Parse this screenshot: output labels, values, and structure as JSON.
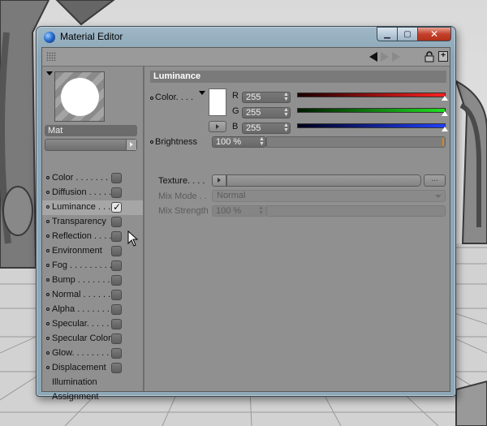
{
  "window": {
    "title": "Material Editor"
  },
  "preview": {
    "material_name": "Mat"
  },
  "channels": [
    {
      "label": "Color . . . . . . . .",
      "enabled": false,
      "active": false
    },
    {
      "label": "Diffusion . . . . . .",
      "enabled": false,
      "active": false
    },
    {
      "label": "Luminance . . . .",
      "enabled": true,
      "active": true
    },
    {
      "label": "Transparency",
      "enabled": false,
      "active": false
    },
    {
      "label": "Reflection . . . . .",
      "enabled": false,
      "active": false
    },
    {
      "label": "Environment",
      "enabled": false,
      "active": false
    },
    {
      "label": "Fog . . . . . . . . . .",
      "enabled": false,
      "active": false
    },
    {
      "label": "Bump . . . . . . . .",
      "enabled": false,
      "active": false
    },
    {
      "label": "Normal . . . . . . .",
      "enabled": false,
      "active": false
    },
    {
      "label": "Alpha . . . . . . . .",
      "enabled": false,
      "active": false
    },
    {
      "label": "Specular. . . . . .",
      "enabled": false,
      "active": false
    },
    {
      "label": "Specular Color",
      "enabled": false,
      "active": false
    },
    {
      "label": "Glow. . . . . . . . .",
      "enabled": false,
      "active": false
    },
    {
      "label": "Displacement",
      "enabled": false,
      "active": false
    }
  ],
  "extra_items": [
    "Illumination",
    "Assignment"
  ],
  "luminance": {
    "header": "Luminance",
    "color_label": "Color. . . .",
    "swatch_color": "#ffffff",
    "r_label": "R",
    "r_value": "255",
    "g_label": "G",
    "g_value": "255",
    "b_label": "B",
    "b_value": "255",
    "brightness_label": "Brightness",
    "brightness_value": "100 %",
    "brightness_level": 1.0,
    "texture_label": "Texture. . . .",
    "texture_more": "...",
    "mixmode_label": "Mix Mode . .",
    "mixmode_value": "Normal",
    "mixstrength_label": "Mix Strength",
    "mixstrength_value": "100 %"
  }
}
